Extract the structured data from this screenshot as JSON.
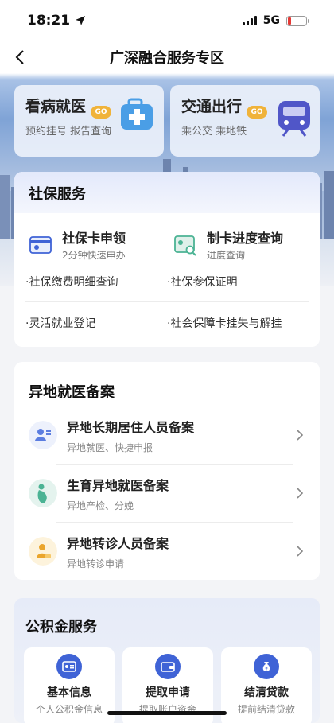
{
  "status_bar": {
    "time": "18:21",
    "network": "5G"
  },
  "nav": {
    "title": "广深融合服务专区"
  },
  "quick_cards": [
    {
      "title": "看病就医",
      "badge": "GO",
      "subtitle": "预约挂号 报告查询",
      "icon": "medical-kit-icon"
    },
    {
      "title": "交通出行",
      "badge": "GO",
      "subtitle": "乘公交 乘地铁",
      "icon": "subway-train-icon"
    }
  ],
  "social_insurance": {
    "title": "社保服务",
    "featured": [
      {
        "title": "社保卡申领",
        "subtitle": "2分钟快速申办",
        "icon": "id-card-icon"
      },
      {
        "title": "制卡进度查询",
        "subtitle": "进度查询",
        "icon": "card-search-icon"
      }
    ],
    "links": [
      "·社保缴费明细查询",
      "·社保参保证明",
      "·灵活就业登记",
      "·社会保障卡挂失与解挂"
    ]
  },
  "remote_medical": {
    "title": "异地就医备案",
    "items": [
      {
        "title": "异地长期居住人员备案",
        "subtitle": "异地就医、快捷申报",
        "icon": "person-document-icon"
      },
      {
        "title": "生育异地就医备案",
        "subtitle": "异地产检、分娩",
        "icon": "pregnancy-icon"
      },
      {
        "title": "异地转诊人员备案",
        "subtitle": "异地转诊申请",
        "icon": "person-transfer-icon"
      }
    ]
  },
  "housing_fund": {
    "title": "公积金服务",
    "cards": [
      {
        "title": "基本信息",
        "subtitle": "个人公积金信息",
        "icon": "id-card-icon"
      },
      {
        "title": "提取申请",
        "subtitle": "提取账户资金",
        "icon": "wallet-icon"
      },
      {
        "title": "结清贷款",
        "subtitle": "提前结清贷款",
        "icon": "money-bag-icon"
      }
    ]
  },
  "colors": {
    "accent": "#3f63d6",
    "badge": "#f0b33a",
    "battery_low": "#e53935"
  }
}
